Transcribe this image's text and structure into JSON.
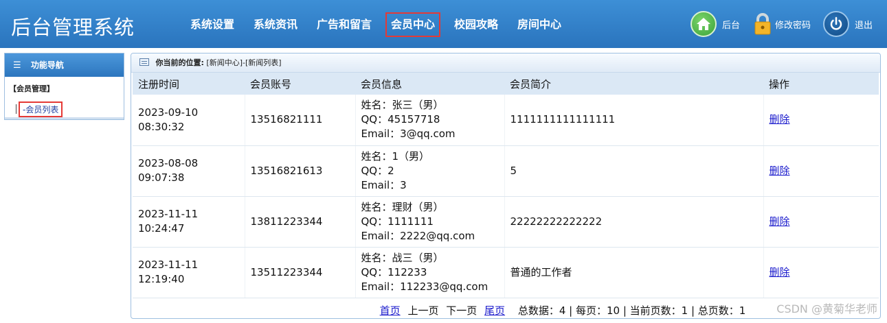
{
  "header": {
    "logo": "后台管理系统",
    "nav": [
      {
        "label": "系统设置",
        "active": false
      },
      {
        "label": "系统资讯",
        "active": false
      },
      {
        "label": "广告和留言",
        "active": false
      },
      {
        "label": "会员中心",
        "active": true
      },
      {
        "label": "校园攻略",
        "active": false
      },
      {
        "label": "房间中心",
        "active": false
      }
    ],
    "tools": {
      "home_label": "后台",
      "password_label": "修改密码",
      "logout_label": "退出"
    }
  },
  "sidebar": {
    "title": "功能导航",
    "group": "【会员管理】",
    "item": "-会员列表"
  },
  "breadcrumb": {
    "prefix": "你当前的位置:",
    "path": "[新闻中心]-[新闻列表]"
  },
  "table": {
    "headers": [
      "注册时间",
      "会员账号",
      "会员信息",
      "会员简介",
      "操作"
    ],
    "rows": [
      {
        "date": "2023-09-10",
        "time": "08:30:32",
        "account": "13516821111",
        "name": "姓名：张三（男）",
        "qq": "QQ：45157718",
        "email": "Email：3@qq.com",
        "intro": "1111111111111111",
        "action": "删除"
      },
      {
        "date": "2023-08-08",
        "time": "09:07:38",
        "account": "13516821613",
        "name": "姓名：1（男）",
        "qq": "QQ：2",
        "email": "Email：3",
        "intro": "5",
        "action": "删除"
      },
      {
        "date": "2023-11-11",
        "time": "10:24:47",
        "account": "13811223344",
        "name": "姓名：理财（男）",
        "qq": "QQ：1111111",
        "email": "Email：2222@qq.com",
        "intro": "22222222222222",
        "action": "删除"
      },
      {
        "date": "2023-11-11",
        "time": "12:19:40",
        "account": "13511223344",
        "name": "姓名：战三（男）",
        "qq": "QQ：112233",
        "email": "Email：112233@qq.com",
        "intro": "普通的工作者",
        "action": "删除"
      }
    ]
  },
  "pager": {
    "first": "首页",
    "prev": "上一页",
    "next": "下一页",
    "last": "尾页",
    "summary": "总数据：4 | 每页：10 | 当前页数：1 | 总页数：1"
  },
  "watermark": "CSDN @黄菊华老师",
  "colors": {
    "header_bg": "#2a74bd",
    "highlight": "#e53935",
    "link": "#1a1acc",
    "table_header": "#dbe8f5"
  },
  "icons": [
    "home-icon",
    "lock-icon",
    "power-icon",
    "menu-icon",
    "document-icon"
  ]
}
